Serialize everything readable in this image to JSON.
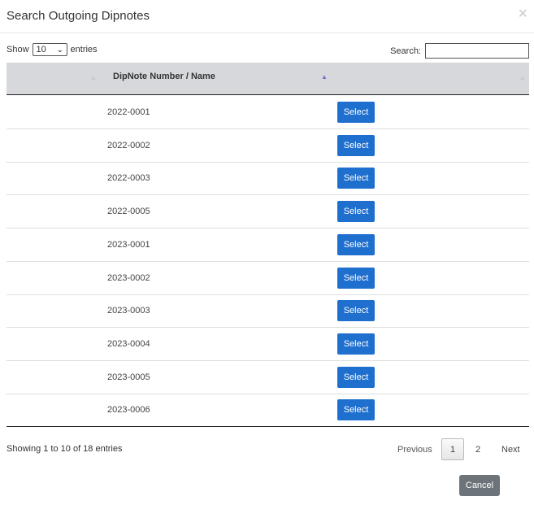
{
  "modal": {
    "title": "Search Outgoing Dipnotes",
    "close_glyph": "×"
  },
  "length": {
    "show_label": "Show",
    "value": "10",
    "entries_label": "entries"
  },
  "search": {
    "label": "Search:",
    "value": ""
  },
  "table": {
    "column_header": "DipNote Number / Name",
    "select_label": "Select",
    "rows": [
      "2022-0001",
      "2022-0002",
      "2022-0003",
      "2022-0005",
      "2023-0001",
      "2023-0002",
      "2023-0003",
      "2023-0004",
      "2023-0005",
      "2023-0006"
    ]
  },
  "info_text": "Showing 1 to 10 of 18 entries",
  "pagination": {
    "previous": "Previous",
    "pages": [
      "1",
      "2"
    ],
    "next": "Next",
    "current": "1"
  },
  "footer": {
    "cancel_label": "Cancel"
  },
  "colors": {
    "select_button": "#1f6fce",
    "cancel_button": "#6d7479",
    "header_bg": "#d6d8dc"
  }
}
